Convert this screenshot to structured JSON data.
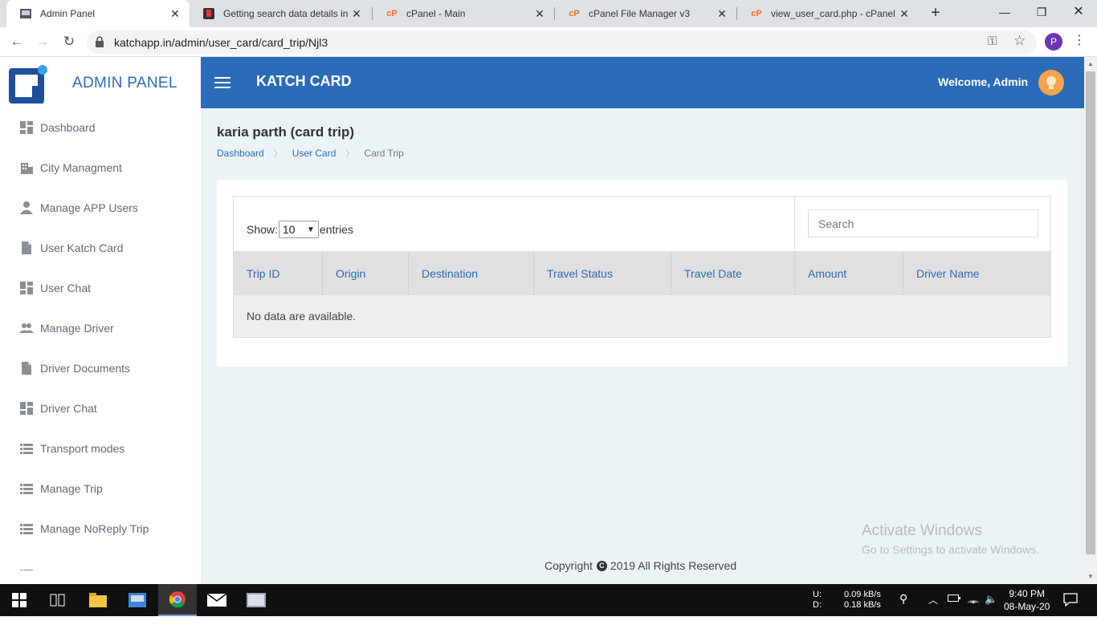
{
  "browser": {
    "tabs": [
      {
        "title": "Admin Panel",
        "active": true
      },
      {
        "title": "Getting search data details in a",
        "active": false
      },
      {
        "title": "cPanel - Main",
        "active": false
      },
      {
        "title": "cPanel File Manager v3",
        "active": false
      },
      {
        "title": "view_user_card.php - cPanel Fi",
        "active": false
      }
    ],
    "url": "katchapp.in/admin/user_card/card_trip/Njl3",
    "profile_initial": "P"
  },
  "sidebar": {
    "brand": "ADMIN PANEL",
    "items": [
      {
        "label": "Dashboard",
        "icon": "dashboard-icon"
      },
      {
        "label": "City Managment",
        "icon": "city-icon"
      },
      {
        "label": "Manage APP Users",
        "icon": "person-icon"
      },
      {
        "label": "User Katch Card",
        "icon": "document-icon"
      },
      {
        "label": "User Chat",
        "icon": "dashboard-icon"
      },
      {
        "label": "Manage Driver",
        "icon": "people-icon"
      },
      {
        "label": "Driver Documents",
        "icon": "document-icon"
      },
      {
        "label": "Driver Chat",
        "icon": "dashboard-icon"
      },
      {
        "label": "Transport modes",
        "icon": "list-icon"
      },
      {
        "label": "Manage Trip",
        "icon": "list-icon"
      },
      {
        "label": "Manage NoReply Trip",
        "icon": "list-icon"
      }
    ]
  },
  "header": {
    "app_title": "KATCH CARD",
    "welcome": "Welcome, Admin"
  },
  "main": {
    "page_title": "karia parth (card trip)",
    "breadcrumbs": [
      "Dashboard",
      "User Card",
      "Card Trip"
    ],
    "show_label": "Show:",
    "entries_value": "10",
    "entries_label": "entries",
    "search_placeholder": "Search",
    "columns": [
      "Trip ID",
      "Origin",
      "Destination",
      "Travel Status",
      "Travel Date",
      "Amount",
      "Driver Name"
    ],
    "empty_message": "No data are available."
  },
  "footer": {
    "prefix": "Copyright",
    "text": "2019 All Rights Reserved"
  },
  "watermark": {
    "title": "Activate Windows",
    "subtitle": "Go to Settings to activate Windows."
  },
  "taskbar": {
    "net_labels": [
      "U:",
      "D:"
    ],
    "net_values": [
      "0.09 kB/s",
      "0.18 kB/s"
    ],
    "time": "9:40 PM",
    "date": "08-May-20"
  },
  "colors": {
    "accent": "#2c6bb8",
    "page_bg": "#ecf3f7",
    "table_header_bg": "#e0e0e0"
  }
}
